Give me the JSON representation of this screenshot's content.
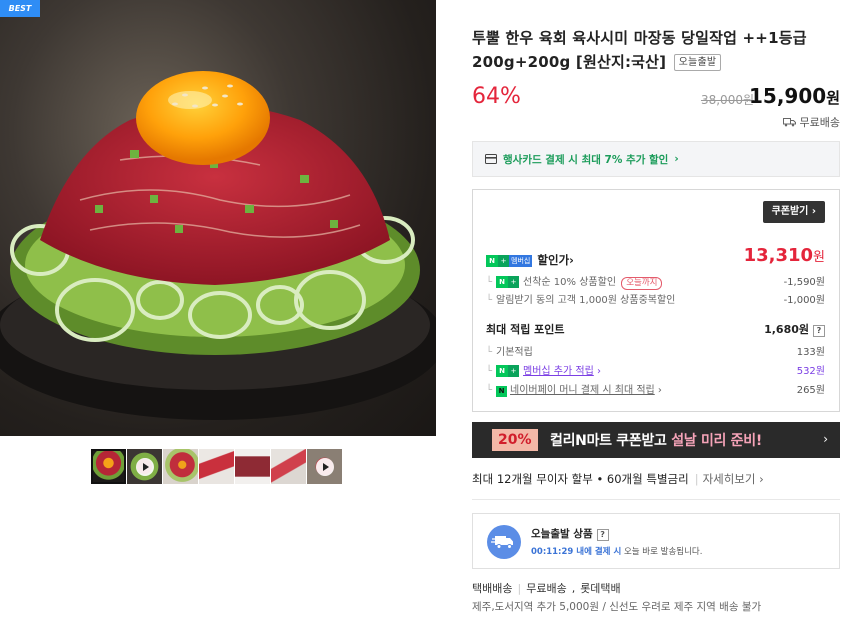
{
  "gallery": {
    "badge": "BEST",
    "thumbnails": [
      {
        "name": "thumb-1",
        "video": false,
        "active": true
      },
      {
        "name": "thumb-2",
        "video": true,
        "active": false
      },
      {
        "name": "thumb-3",
        "video": false,
        "active": false
      },
      {
        "name": "thumb-4",
        "video": false,
        "active": false
      },
      {
        "name": "thumb-5",
        "video": false,
        "active": false
      },
      {
        "name": "thumb-6",
        "video": false,
        "active": false
      },
      {
        "name": "thumb-7",
        "video": true,
        "active": false
      }
    ]
  },
  "product": {
    "title": "투뿔 한우 육회 육사시미 마장동 당일작업 ++1등급 200g+200g [원산지:국산]",
    "today_tag": "오늘출발",
    "discount_rate": "64%",
    "original_price": "38,000원",
    "price": "15,900",
    "price_unit": "원",
    "delivery_free": "무료배송"
  },
  "card_banner": {
    "text": "행사카드 결제 시 최대 7% 추가 할인",
    "arrow": "›"
  },
  "coupon": {
    "button": "쿠폰받기",
    "button_arrow": "›",
    "membership_badge": "멤버십",
    "sale_label": "할인가",
    "sale_price": "13,310",
    "sale_unit": "원",
    "items": [
      {
        "label": "선착순 10% 상품할인",
        "tag": "오늘까지",
        "amount": "-1,590원"
      },
      {
        "label": "알림받기 동의 고객 1,000원 상품중복할인",
        "amount": "-1,000원"
      }
    ],
    "points_label": "최대 적립 포인트",
    "points_total": "1,680원",
    "points_help": "?",
    "points": [
      {
        "label": "기본적립",
        "amount": "133원"
      },
      {
        "label": "멤버십 추가 적립",
        "amount": "532원"
      },
      {
        "label": "네이버페이 머니 결제 시 최대 적립",
        "amount": "265원"
      }
    ]
  },
  "promo": {
    "tag": "20%",
    "text_pre": "컬리N마트 쿠폰받고 ",
    "text_highlight": "설날 미리 준비!",
    "arrow": "›"
  },
  "installment": {
    "text": "최대 12개월 무이자 할부 • 60개월 특별금리",
    "more": "자세히보기 ›"
  },
  "shipping": {
    "title": "오늘출발 상품",
    "help": "?",
    "countdown": "00:11:29 내에 결제 시",
    "desc": " 오늘 바로 발송됩니다.",
    "method_1": "택배배송",
    "method_2": "무료배송",
    "method_3": "롯데택배",
    "note": "제주,도서지역 추가 5,000원 / 신선도 우려로 제주 지역 배송 불가"
  },
  "colors": {
    "discount_red": "#e4253b",
    "naver_green": "#03c75a",
    "membership_purple": "#7b3fe4"
  }
}
